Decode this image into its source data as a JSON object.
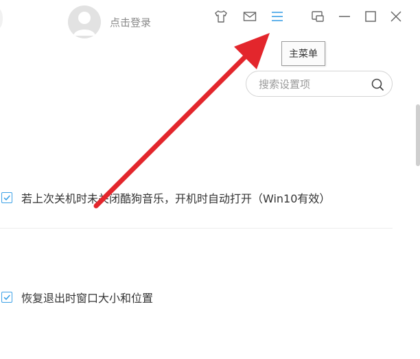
{
  "header": {
    "login_label": "点击登录",
    "icons": [
      "avatar-icon",
      "skin-icon",
      "mail-icon",
      "main-menu-icon",
      "mini-mode-icon",
      "minimize-icon",
      "maximize-icon",
      "close-icon"
    ]
  },
  "tooltip": {
    "text": "主菜单"
  },
  "search": {
    "placeholder": "搜索设置项",
    "value": ""
  },
  "settings": {
    "items": [
      {
        "label": "若上次关机时未关闭酷狗音乐，开机时自动打开（Win10有效）",
        "checked": true
      },
      {
        "label": "恢复退出时窗口大小和位置",
        "checked": true
      }
    ]
  },
  "colors": {
    "accent": "#3aa0e6",
    "annotation_arrow": "#e3262c",
    "text": "#333333",
    "muted_text": "#8a8a8a"
  }
}
